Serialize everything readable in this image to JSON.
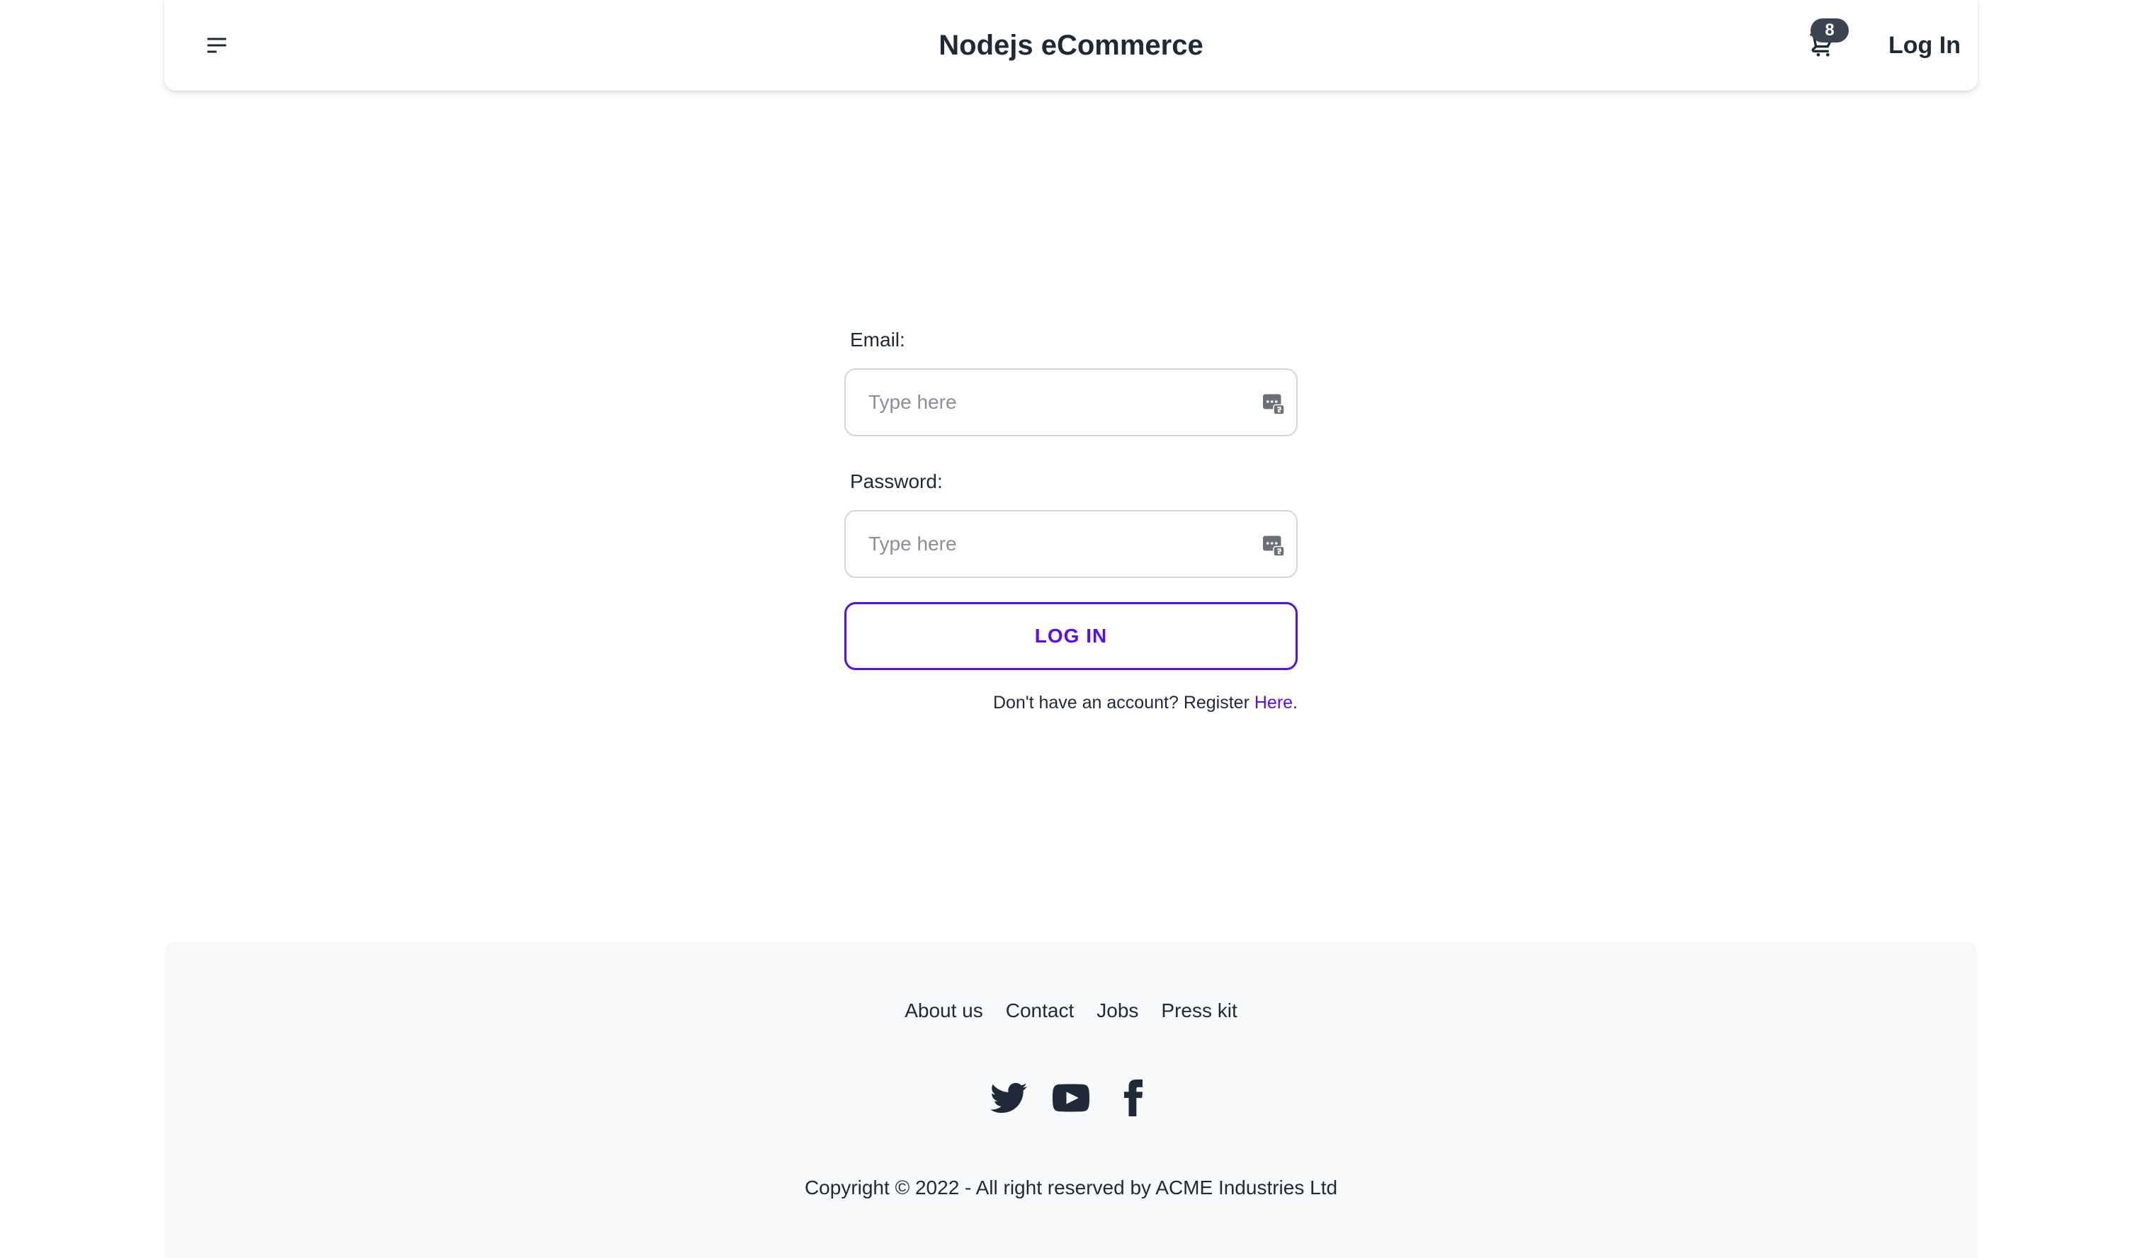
{
  "navbar": {
    "menu_icon": "hamburger-menu-icon",
    "brand": "Nodejs eCommerce",
    "cart_icon": "shopping-cart-icon",
    "cart_count": "8",
    "login_label": "Log In"
  },
  "form": {
    "email_label": "Email:",
    "email_placeholder": "Type here",
    "password_label": "Password:",
    "password_placeholder": "Type here",
    "autofill_icon": "password-manager-icon",
    "submit_label": "LOG IN",
    "register_prefix": "Don't have an account? Register ",
    "register_link": "Here",
    "register_suffix": "."
  },
  "footer": {
    "links": [
      "About us",
      "Contact",
      "Jobs",
      "Press kit"
    ],
    "social_icons": [
      "twitter-icon",
      "youtube-icon",
      "facebook-icon"
    ],
    "copyright": "Copyright © 2022 - All right reserved by ACME Industries Ltd"
  },
  "colors": {
    "accent": "#570df8",
    "badge": "#3d4451",
    "footer_bg": "#f8f9fb",
    "text": "#1f2937"
  }
}
